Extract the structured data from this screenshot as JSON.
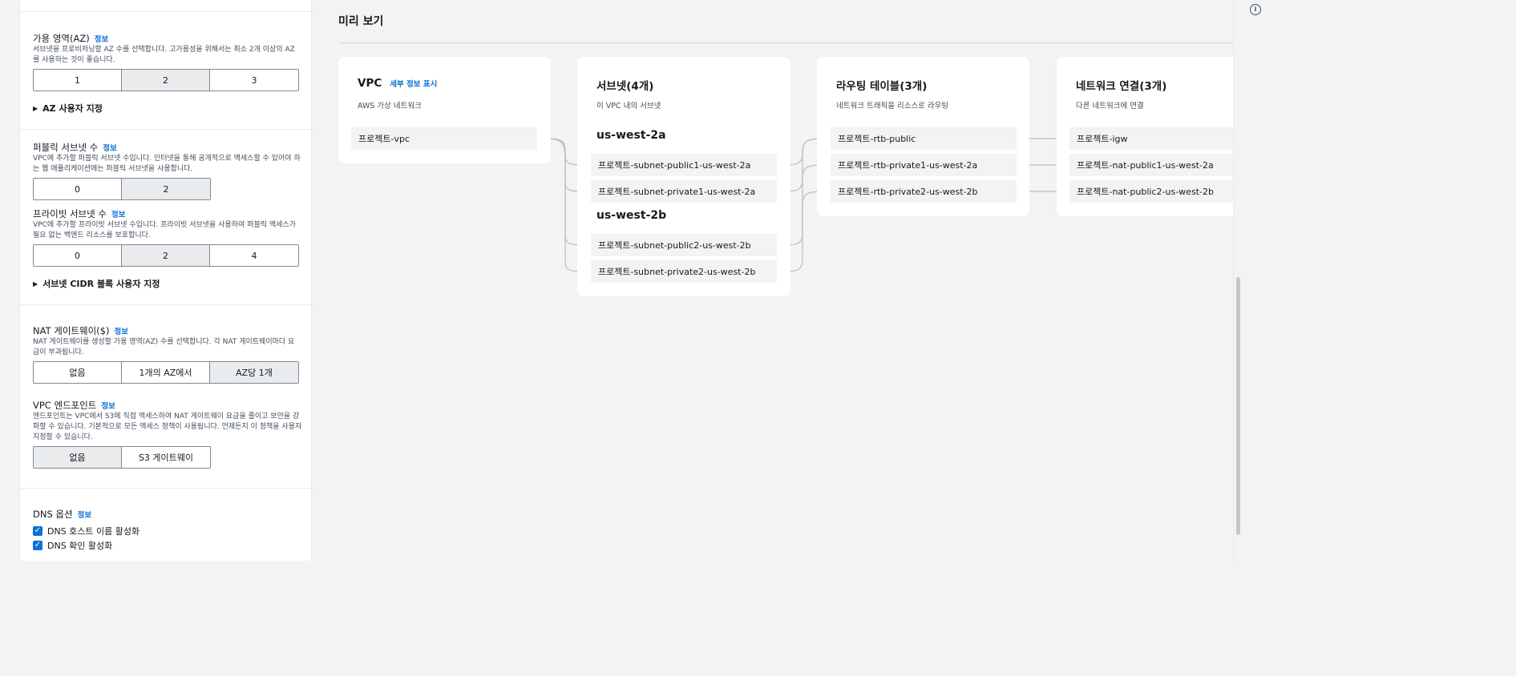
{
  "az": {
    "title": "가용 영역(AZ)",
    "info": "정보",
    "description": "서브넷을 프로비저닝할 AZ 수를 선택합니다. 고가용성을 위해서는 최소 2개 이상의 AZ를 사용하는 것이 좋습니다.",
    "options": [
      "1",
      "2",
      "3"
    ],
    "selected": "2",
    "custom_toggle": "AZ 사용자 지정"
  },
  "public_subnets": {
    "title": "퍼블릭 서브넷 수",
    "info": "정보",
    "description": "VPC에 추가할 퍼블릭 서브넷 수입니다. 인터넷을 통해 공개적으로 액세스할 수 있어야 하는 웹 애플리케이션에는 퍼블릭 서브넷을 사용합니다.",
    "options": [
      "0",
      "2"
    ],
    "selected": "2"
  },
  "private_subnets": {
    "title": "프라이빗 서브넷 수",
    "info": "정보",
    "description": "VPC에 추가할 프라이빗 서브넷 수입니다. 프라이빗 서브넷을 사용하여 퍼블릭 액세스가 필요 없는 백엔드 리소스를 보호합니다.",
    "options": [
      "0",
      "2",
      "4"
    ],
    "selected": "2",
    "custom_toggle": "서브넷 CIDR 블록 사용자 지정"
  },
  "nat": {
    "title": "NAT 게이트웨이($)",
    "info": "정보",
    "description": "NAT 게이트웨이를 생성할 가용 영역(AZ) 수를 선택합니다. 각 NAT 게이트웨이마다 요금이 부과됩니다.",
    "options": [
      "없음",
      "1개의 AZ에서",
      "AZ당 1개"
    ],
    "selected": "AZ당 1개"
  },
  "endpoints": {
    "title": "VPC 엔드포인트",
    "info": "정보",
    "description": "엔드포인트는 VPC에서 S3에 직접 액세스하여 NAT 게이트웨이 요금을 줄이고 보안을 강화할 수 있습니다. 기본적으로 모든 액세스 정책이 사용됩니다. 언제든지 이 정책을 사용자 지정할 수 있습니다.",
    "options": [
      "없음",
      "S3 게이트웨이"
    ],
    "selected": "없음"
  },
  "dns": {
    "title": "DNS 옵션",
    "info": "정보",
    "hostnames": "DNS 호스트 이름 활성화",
    "resolution": "DNS 확인 활성화",
    "hostnames_checked": true,
    "resolution_checked": true
  },
  "preview": {
    "title": "미리 보기",
    "vpc": {
      "title": "VPC",
      "detail_link": "세부 정보 표시",
      "subtitle": "AWS 가상 네트워크",
      "name": "프로젝트-vpc"
    },
    "subnets": {
      "title": "서브넷(4개)",
      "subtitle": "이 VPC 내의 서브넷",
      "az1": "us-west-2a",
      "az2": "us-west-2b",
      "items": [
        "프로젝트-subnet-public1-us-west-2a",
        "프로젝트-subnet-private1-us-west-2a",
        "프로젝트-subnet-public2-us-west-2b",
        "프로젝트-subnet-private2-us-west-2b"
      ]
    },
    "route_tables": {
      "title": "라우팅 테이블(3개)",
      "subtitle": "네트워크 트래픽을 리소스로 라우팅",
      "items": [
        "프로젝트-rtb-public",
        "프로젝트-rtb-private1-us-west-2a",
        "프로젝트-rtb-private2-us-west-2b"
      ]
    },
    "connections": {
      "title": "네트워크 연결(3개)",
      "subtitle": "다른 네트워크에 연결",
      "items": [
        "프로젝트-igw",
        "프로젝트-nat-public1-us-west-2a",
        "프로젝트-nat-public2-us-west-2b"
      ]
    }
  },
  "icons": {
    "expand": "caret-right-icon",
    "checkbox": "checkmark-icon",
    "edge": "info-circle-icon"
  },
  "colors": {
    "link": "#0972d3",
    "selected_segment": "#e9ebed",
    "checkbox": "#0972d3",
    "connector": "#b8bdc4"
  }
}
